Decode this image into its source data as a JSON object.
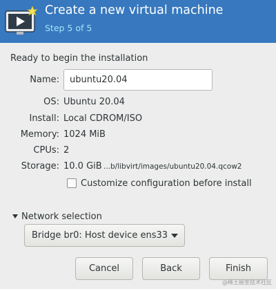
{
  "header": {
    "title": "Create a new virtual machine",
    "step": "Step 5 of 5",
    "icon": "monitor-play-icon"
  },
  "summary": {
    "heading": "Ready to begin the installation",
    "name_label": "Name:",
    "name_value": "ubuntu20.04",
    "os_label": "OS:",
    "os_value": "Ubuntu 20.04",
    "install_label": "Install:",
    "install_value": "Local CDROM/ISO",
    "memory_label": "Memory:",
    "memory_value": "1024 MiB",
    "cpus_label": "CPUs:",
    "cpus_value": "2",
    "storage_label": "Storage:",
    "storage_size": "10.0 GiB",
    "storage_path": "...b/libvirt/images/ubuntu20.04.qcow2",
    "customize_label": "Customize configuration before install",
    "customize_checked": false
  },
  "network": {
    "expander_label": "Network selection",
    "selected": "Bridge br0: Host device ens33"
  },
  "buttons": {
    "cancel": "Cancel",
    "back": "Back",
    "finish": "Finish"
  },
  "watermark": "@稀土掘金技术社区",
  "colors": {
    "header_bg": "#3778be",
    "step_text": "#a7e3f8",
    "window_bg": "#ededed"
  }
}
